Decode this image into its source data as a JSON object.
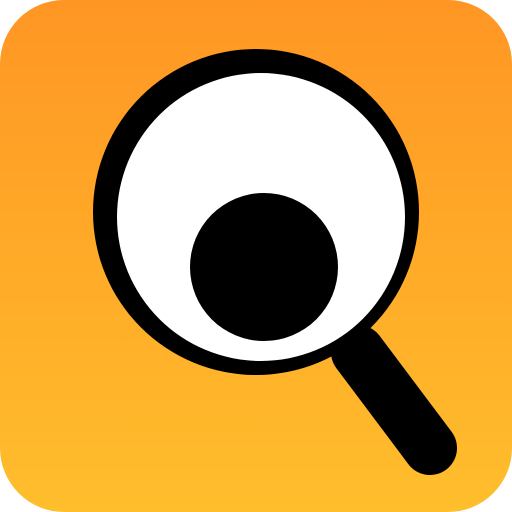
{
  "icon": {
    "name": "magnifier-eye-app-icon",
    "colors": {
      "background_top": "#FF9624",
      "background_bottom": "#FFBE2C",
      "stroke": "#000000",
      "lens_fill": "#FFFFFF",
      "pupil": "#000000"
    }
  }
}
